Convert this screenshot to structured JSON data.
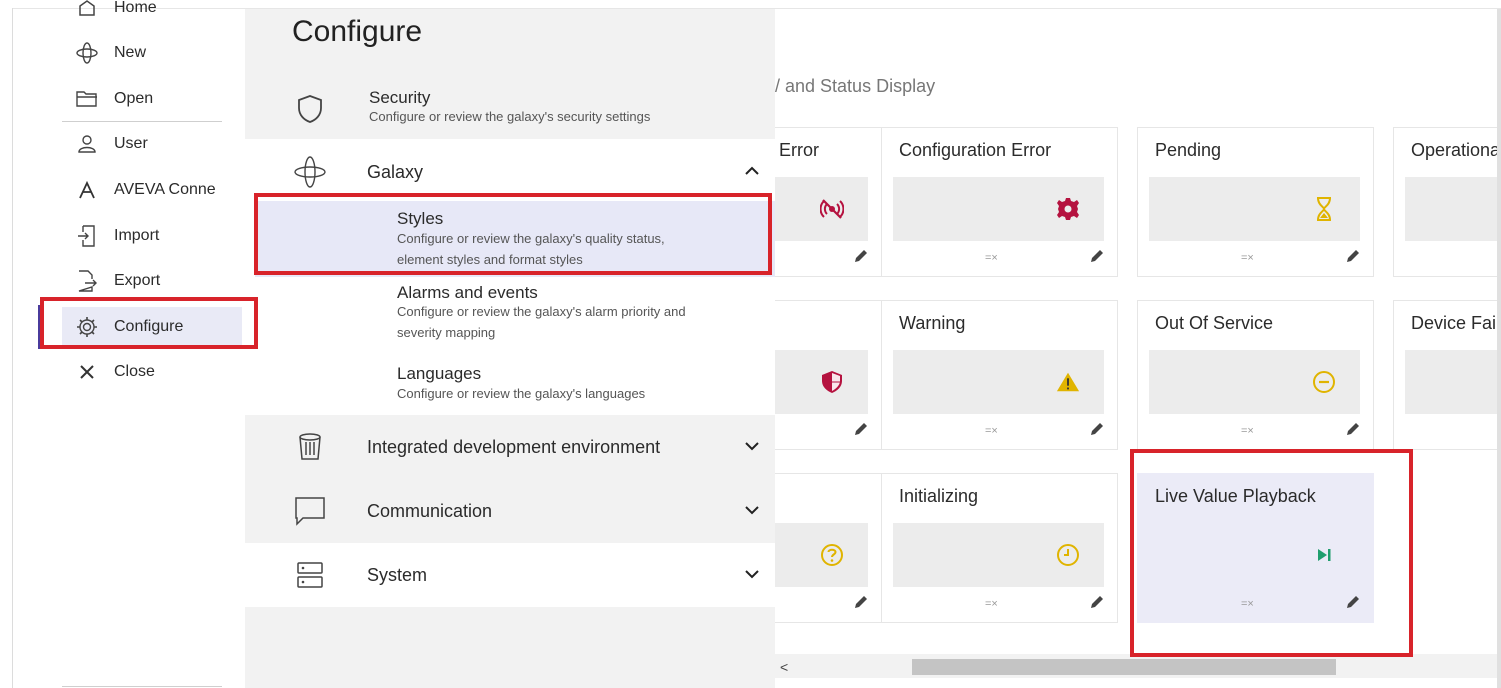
{
  "nav": {
    "items": [
      {
        "label": "Home",
        "icon": "home-icon"
      },
      {
        "label": "New",
        "icon": "galaxy-icon"
      },
      {
        "label": "Open",
        "icon": "folder-open-icon"
      },
      {
        "label": "User",
        "icon": "user-icon"
      },
      {
        "label": "AVEVA Conne",
        "icon": "aveva-logo-icon"
      },
      {
        "label": "Import",
        "icon": "import-icon"
      },
      {
        "label": "Export",
        "icon": "export-icon"
      },
      {
        "label": "Configure",
        "icon": "gear-icon"
      },
      {
        "label": "Close",
        "icon": "close-icon"
      }
    ]
  },
  "configure": {
    "title": "Configure",
    "sections": [
      {
        "title": "Security",
        "subtitle": "Configure or review the galaxy's security settings",
        "icon": "shield-icon"
      },
      {
        "title": "Galaxy",
        "icon": "galaxy-icon",
        "expanded": true,
        "children": [
          {
            "title": "Styles",
            "desc": "Configure or review the galaxy's quality status, element styles and format styles"
          },
          {
            "title": "Alarms and events",
            "desc": "Configure or review the galaxy's alarm priority and severity mapping"
          },
          {
            "title": "Languages",
            "desc": "Configure or review the galaxy's languages"
          }
        ]
      },
      {
        "title": "Integrated development environment",
        "icon": "trash-bin-icon"
      },
      {
        "title": "Communication",
        "icon": "chat-bubble-icon"
      },
      {
        "title": "System",
        "icon": "server-icon"
      }
    ]
  },
  "content": {
    "header": "/ and Status Display",
    "format_glyph": "=×",
    "cards": [
      {
        "title": "Error",
        "icon": "signal-error-icon",
        "color": "#b5123f"
      },
      {
        "title": "Configuration Error",
        "icon": "gear-icon",
        "color": "#b5123f"
      },
      {
        "title": "Pending",
        "icon": "hourglass-icon",
        "color": "#e0b400"
      },
      {
        "title": "Operationa",
        "icon": "",
        "color": ""
      },
      {
        "title": "",
        "icon": "shield-alert-icon",
        "color": "#b5123f"
      },
      {
        "title": "Warning",
        "icon": "warning-icon",
        "color": "#e0b400"
      },
      {
        "title": "Out Of Service",
        "icon": "minus-circle-icon",
        "color": "#e0b400"
      },
      {
        "title": "Device Failu",
        "icon": "",
        "color": ""
      },
      {
        "title": "",
        "icon": "question-circle-icon",
        "color": "#e0b400"
      },
      {
        "title": "Initializing",
        "icon": "clock-icon",
        "color": "#e0b400"
      },
      {
        "title": "Live Value Playback",
        "icon": "play-next-icon",
        "color": "#1f9e6e"
      }
    ]
  },
  "scroll": {
    "left_arrow": "<"
  }
}
